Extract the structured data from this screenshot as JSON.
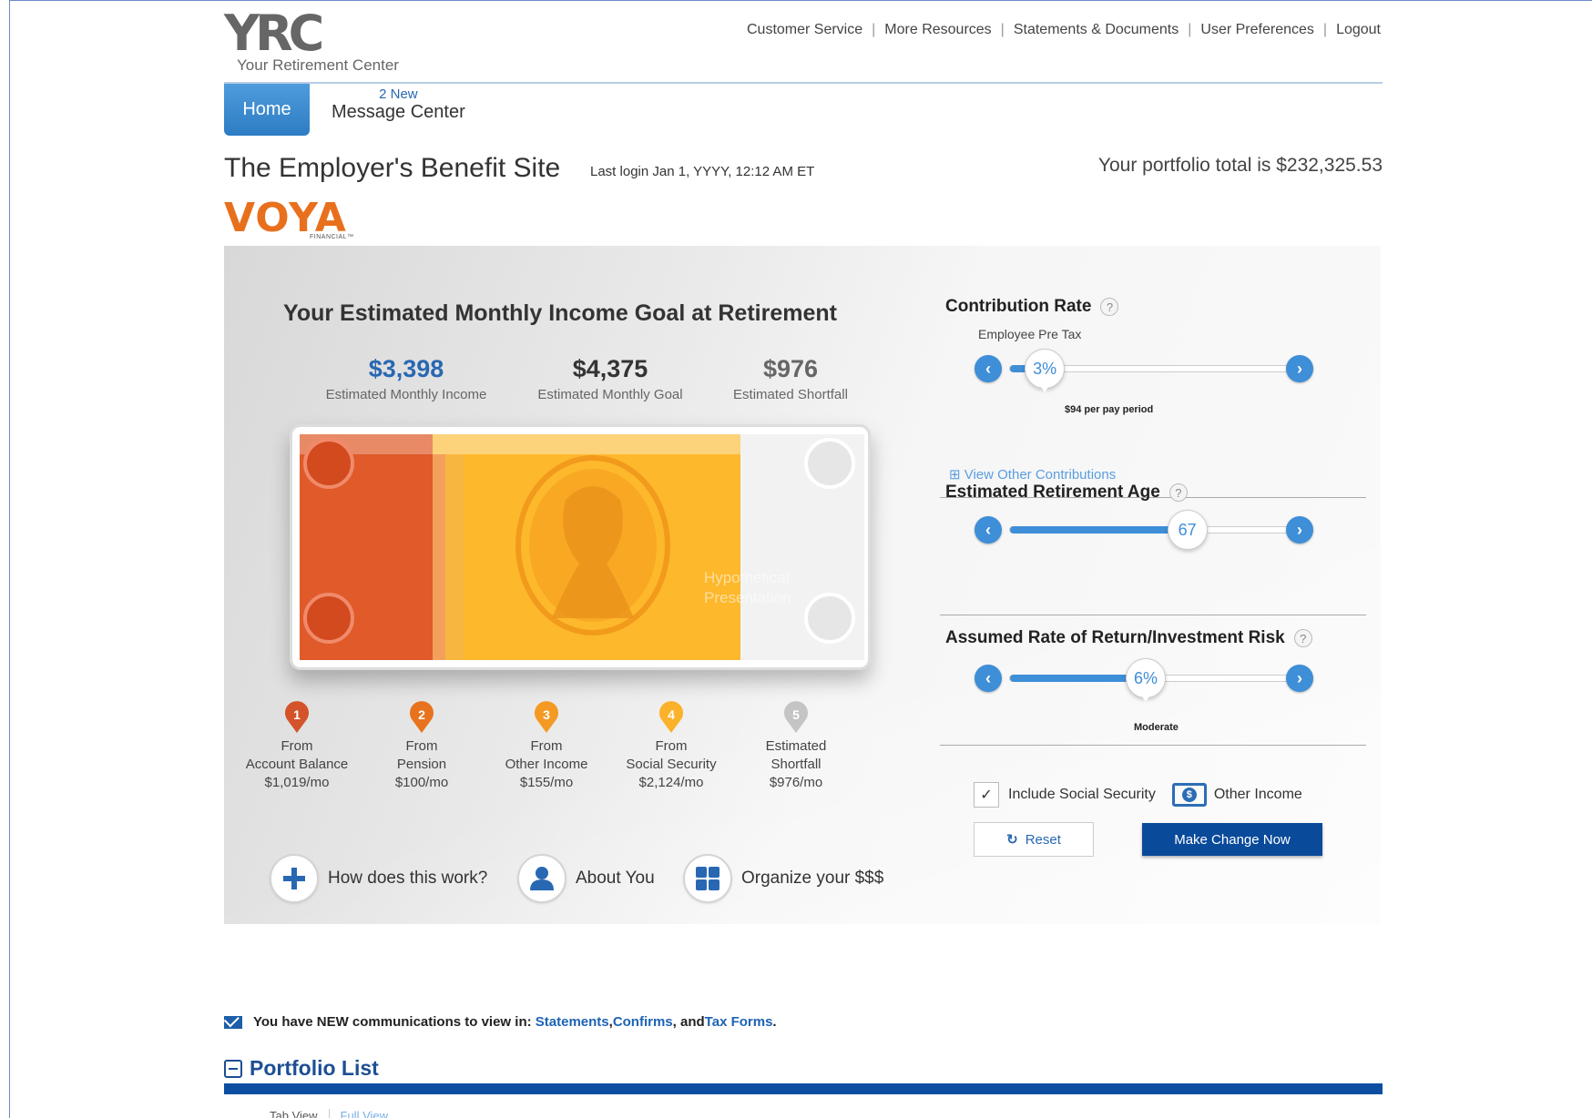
{
  "header": {
    "logo_mark": "YRC",
    "logo_sub": "Your Retirement Center",
    "nav": [
      "Customer Service",
      "More Resources",
      "Statements & Documents",
      "User Preferences",
      "Logout"
    ]
  },
  "tabs": {
    "home": "Home",
    "messages_new": "2 New",
    "messages_label": "Message Center"
  },
  "site": {
    "title": "The Employer's Benefit Site",
    "last_login": "Last login Jan 1, YYYY, 12:12 AM ET",
    "portfolio_total": "Your portfolio total is $232,325.53",
    "brand": "VOYA",
    "brand_sub": "FINANCIAL™"
  },
  "goal": {
    "title": "Your Estimated Monthly Income Goal at Retirement",
    "income_value": "$3,398",
    "income_label": "Estimated Monthly Income",
    "goal_value": "$4,375",
    "goal_label": "Estimated Monthly Goal",
    "shortfall_value": "$976",
    "shortfall_label": "Estimated Shortfall",
    "watermark_line1": "Hypothetical",
    "watermark_line2": "Presentation",
    "colors": {
      "account": "#e0602c",
      "pension": "#f08a24",
      "other": "#f7a92b",
      "social": "#fdb92b",
      "shortfall": "#c8c8c8",
      "brand_blue": "#2868b3"
    }
  },
  "sources": [
    {
      "num": "1",
      "line1": "From",
      "line2": "Account Balance",
      "line3": "$1,019/mo",
      "color": "#d4532a"
    },
    {
      "num": "2",
      "line1": "From",
      "line2": "Pension",
      "line3": "$100/mo",
      "color": "#e8731f"
    },
    {
      "num": "3",
      "line1": "From",
      "line2": "Other Income",
      "line3": "$155/mo",
      "color": "#f49a24"
    },
    {
      "num": "4",
      "line1": "From",
      "line2": "Social Security",
      "line3": "$2,124/mo",
      "color": "#fbb22a"
    },
    {
      "num": "5",
      "line1": "Estimated",
      "line2": "Shortfall",
      "line3": "$976/mo",
      "color": "#c4c4c4"
    }
  ],
  "actions": {
    "how": "How does this work?",
    "about": "About You",
    "organize": "Organize your $$$"
  },
  "controls": {
    "contribution": {
      "title": "Contribution Rate",
      "help": "?",
      "sub": "Employee Pre Tax",
      "value": "3%",
      "level": 0.12,
      "note": "$94 per pay period"
    },
    "view_other": "⊞ View Other Contributions",
    "retirement_age": {
      "title": "Estimated Retirement Age",
      "help": "?",
      "value": "67",
      "level": 0.6
    },
    "return_risk": {
      "title": "Assumed Rate of Return/Investment Risk",
      "help": "?",
      "value": "6%",
      "level": 0.46,
      "note": "Moderate"
    },
    "include_ss": "Include Social Security",
    "include_ss_checked": "✓",
    "other_income": "Other Income",
    "reset": "Reset",
    "reset_icon": "↻",
    "make_change": "Make Change Now"
  },
  "notice": {
    "prefix": "You have NEW communications to view in: ",
    "link1": "Statements",
    "sep1": ", ",
    "link2": "Confirms",
    "sep2": ", and ",
    "link3": "Tax Forms",
    "end": "."
  },
  "portfolio": {
    "title": "Portfolio List",
    "tab_view": "Tab View",
    "full_view": "Full View"
  }
}
